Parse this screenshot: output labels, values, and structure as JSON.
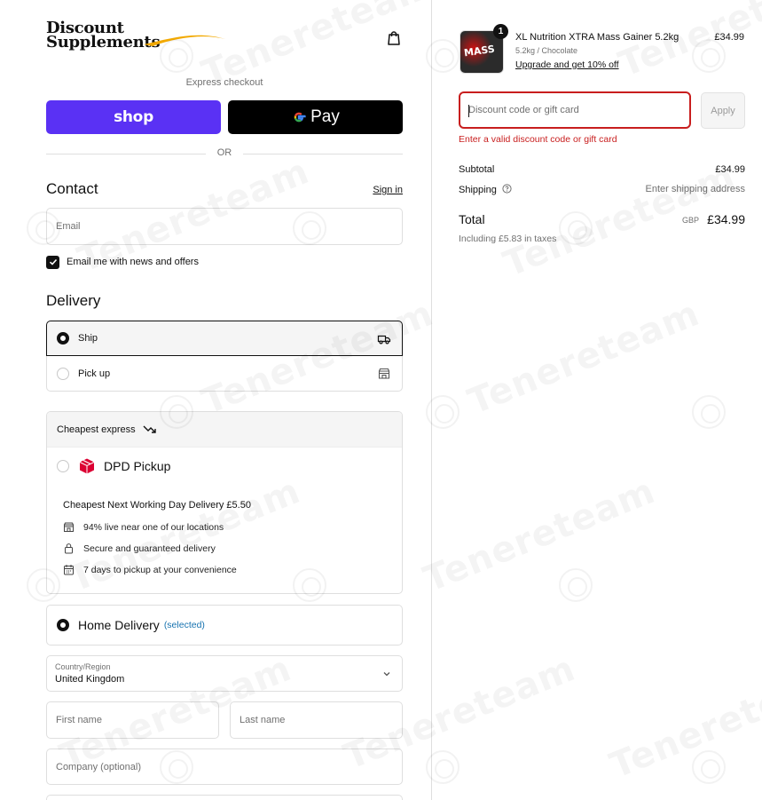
{
  "header": {
    "logo_line1": "Discount",
    "logo_line2": "Supplements"
  },
  "express": {
    "title": "Express checkout",
    "shop_label": "shop",
    "gpay_g": "G",
    "gpay_label": "Pay",
    "or_label": "OR"
  },
  "contact": {
    "title": "Contact",
    "signin_label": "Sign in",
    "email_placeholder": "Email",
    "newsletter_label": "Email me with news and offers",
    "newsletter_checked": true
  },
  "delivery": {
    "title": "Delivery",
    "options": [
      {
        "label": "Ship",
        "selected": true,
        "icon": "truck-icon"
      },
      {
        "label": "Pick up",
        "selected": false,
        "icon": "store-icon"
      }
    ],
    "shipping_group": {
      "title": "Cheapest express",
      "title_icon": "trend-down-icon",
      "method_name": "DPD Pickup",
      "method_icon": "dpd-box-icon",
      "description": "Cheapest Next Working Day Delivery £5.50",
      "features": [
        {
          "icon": "store-icon",
          "text": "94% live near one of our locations"
        },
        {
          "icon": "lock-icon",
          "text": "Secure and guaranteed delivery"
        },
        {
          "icon": "calendar-icon",
          "text": "7 days to pickup at your convenience"
        }
      ]
    },
    "home_delivery": {
      "name": "Home Delivery",
      "selected_label": "(selected)"
    },
    "country": {
      "label": "Country/Region",
      "value": "United Kingdom"
    },
    "first_name_placeholder": "First name",
    "last_name_placeholder": "Last name",
    "company_placeholder": "Company (optional)"
  },
  "summary": {
    "product": {
      "quantity": "1",
      "name": "XL Nutrition XTRA Mass Gainer 5.2kg",
      "variant": "5.2kg / Chocolate",
      "upsell": "Upgrade and get 10% off",
      "price": "£34.99",
      "image_text": "MASS"
    },
    "discount_placeholder": "Discount code or gift card",
    "apply_label": "Apply",
    "error": "Enter a valid discount code or gift card",
    "subtotal_label": "Subtotal",
    "subtotal_value": "£34.99",
    "shipping_label": "Shipping",
    "shipping_value": "Enter shipping address",
    "total_label": "Total",
    "total_currency": "GBP",
    "total_value": "£34.99",
    "tax_note": "Including £5.83 in taxes"
  },
  "watermark": {
    "text": "Tenereteam"
  },
  "colors": {
    "shop_pay": "#5a31f4",
    "error": "#c81e1e",
    "link_blue": "#1773b0",
    "dpd_red": "#dc0032",
    "logo_swoosh": "#f2a900"
  }
}
